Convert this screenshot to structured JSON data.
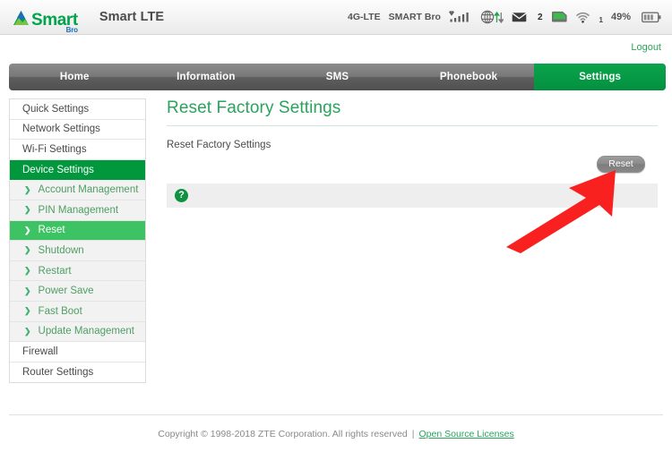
{
  "header": {
    "logo_name": "Smart",
    "logo_sub": "Bro",
    "logo_icon": "mountain-triangle-icon",
    "device_title": "Smart LTE",
    "status": {
      "network_type": "4G-LTE",
      "carrier": "SMART Bro",
      "signal_icon": "signal-bars-icon",
      "globe_icon": "globe-transfer-icon",
      "mail_icon": "envelope-icon",
      "mail_count": "2",
      "sim_icon": "sim-card-icon",
      "wifi_icon": "wifi-icon",
      "wifi_count": "1",
      "battery_percent": "49%",
      "battery_icon": "battery-icon"
    }
  },
  "logout": {
    "label": "Logout"
  },
  "nav": {
    "tabs": [
      {
        "label": "Home",
        "active": false
      },
      {
        "label": "Information",
        "active": false
      },
      {
        "label": "SMS",
        "active": false
      },
      {
        "label": "Phonebook",
        "active": false
      },
      {
        "label": "Settings",
        "active": true
      }
    ]
  },
  "sidebar": {
    "items": [
      {
        "label": "Quick Settings",
        "type": "top",
        "active": false
      },
      {
        "label": "Network Settings",
        "type": "top",
        "active": false
      },
      {
        "label": "Wi-Fi Settings",
        "type": "top",
        "active": false
      },
      {
        "label": "Device Settings",
        "type": "top",
        "active": true
      },
      {
        "label": "Account Management",
        "type": "sub",
        "active": false
      },
      {
        "label": "PIN Management",
        "type": "sub",
        "active": false
      },
      {
        "label": "Reset",
        "type": "sub",
        "active": true
      },
      {
        "label": "Shutdown",
        "type": "sub",
        "active": false
      },
      {
        "label": "Restart",
        "type": "sub",
        "active": false
      },
      {
        "label": "Power Save",
        "type": "sub",
        "active": false
      },
      {
        "label": "Fast Boot",
        "type": "sub",
        "active": false
      },
      {
        "label": "Update Management",
        "type": "sub",
        "active": false
      },
      {
        "label": "Firewall",
        "type": "top",
        "active": false
      },
      {
        "label": "Router Settings",
        "type": "top",
        "active": false
      }
    ]
  },
  "main": {
    "page_title": "Reset Factory Settings",
    "section_label": "Reset Factory Settings",
    "reset_button_label": "Reset",
    "help_icon": "question-mark-icon",
    "help_icon_label": "?"
  },
  "annotation": {
    "arrow_icon": "red-arrow-pointing-up-right",
    "arrow_color": "#f92020"
  },
  "footer": {
    "copyright": "Copyright © 1998-2018 ZTE Corporation. All rights reserved",
    "separator": "|",
    "oss_link": "Open Source Licenses"
  },
  "colors": {
    "brand_green": "#00a44b",
    "active_tab_green": "#079c46",
    "sidebar_active_dark": "#00973d",
    "sidebar_active_light": "#3dc264",
    "title_green": "#2aa35c",
    "logo_blue": "#1b6fb5"
  }
}
